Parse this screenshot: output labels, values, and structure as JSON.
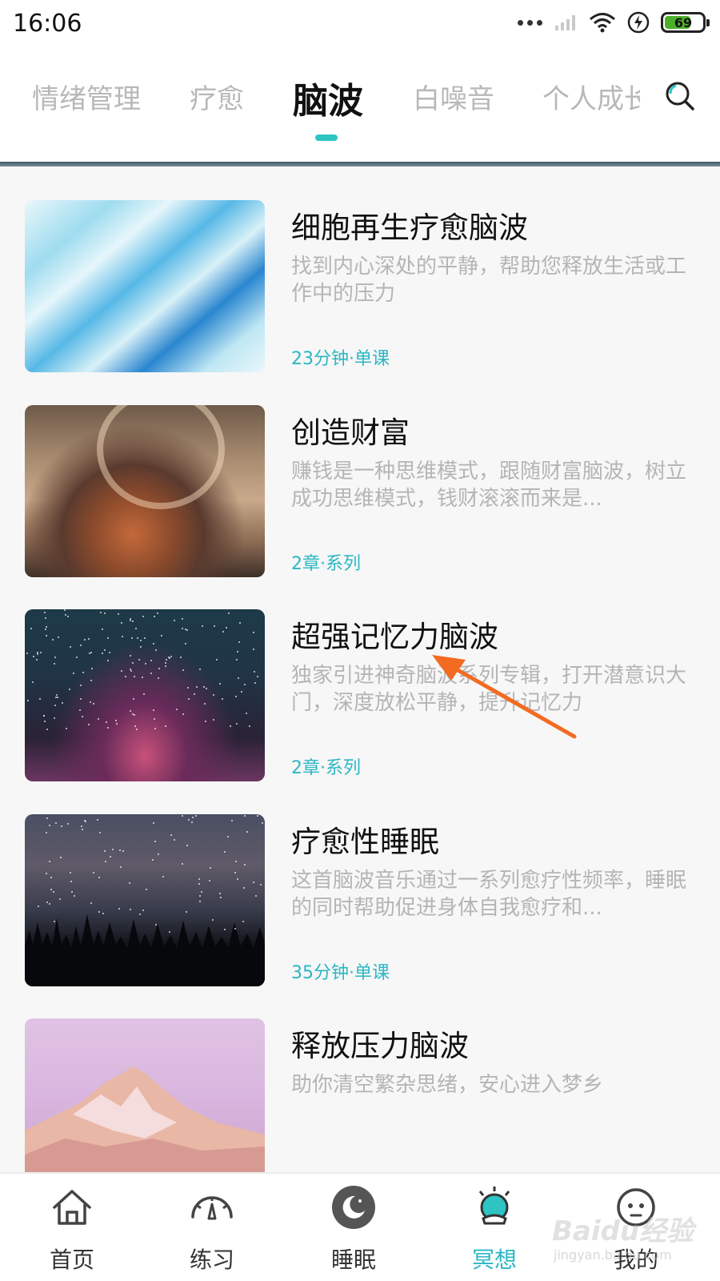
{
  "status_bar": {
    "time": "16:06",
    "battery": "69",
    "battery_level": 0.69
  },
  "tabs": {
    "items": [
      {
        "label": "情绪管理",
        "active": false
      },
      {
        "label": "疗愈",
        "active": false
      },
      {
        "label": "脑波",
        "active": true
      },
      {
        "label": "白噪音",
        "active": false
      },
      {
        "label": "个人成长",
        "active": false
      }
    ],
    "search_icon": "search-icon"
  },
  "list": {
    "items": [
      {
        "title": "细胞再生疗愈脑波",
        "desc": "找到内心深处的平静，帮助您释放生活或工作中的压力",
        "meta": "23分钟·单课"
      },
      {
        "title": "创造财富",
        "desc": "赚钱是一种思维模式，跟随财富脑波，树立成功思维模式，钱财滚滚而来是...",
        "meta": "2章·系列"
      },
      {
        "title": "超强记忆力脑波",
        "desc": "独家引进神奇脑波系列专辑，打开潜意识大门，深度放松平静，提升记忆力",
        "meta": "2章·系列"
      },
      {
        "title": "疗愈性睡眠",
        "desc": "这首脑波音乐通过一系列愈疗性频率，睡眠的同时帮助促进身体自我愈疗和...",
        "meta": "35分钟·单课"
      },
      {
        "title": "释放压力脑波",
        "desc": "助你清空繁杂思绪，安心进入梦乡",
        "meta": ""
      }
    ]
  },
  "bottom_nav": {
    "items": [
      {
        "label": "首页",
        "icon": "home-icon",
        "active": false
      },
      {
        "label": "练习",
        "icon": "gauge-icon",
        "active": false
      },
      {
        "label": "睡眠",
        "icon": "moon-icon",
        "active": false
      },
      {
        "label": "冥想",
        "icon": "meditation-icon",
        "active": true
      },
      {
        "label": "我的",
        "icon": "face-icon",
        "active": false
      }
    ]
  },
  "colors": {
    "accent": "#2bb7c4",
    "text_primary": "#111111",
    "text_muted": "#b5b5b5"
  },
  "watermark": {
    "text": "Baidu经验",
    "sub": "jingyan.baidu.com"
  }
}
